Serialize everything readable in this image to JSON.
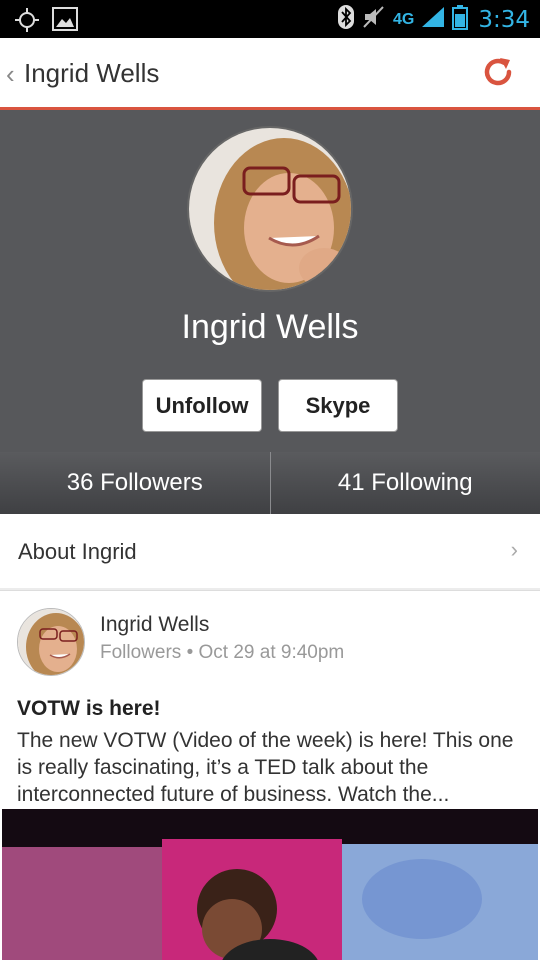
{
  "status_bar": {
    "network": "4G",
    "time": "3:34"
  },
  "action_bar": {
    "title": "Ingrid Wells"
  },
  "profile": {
    "name": "Ingrid Wells",
    "unfollow_label": "Unfollow",
    "skype_label": "Skype",
    "followers_label": "36 Followers",
    "following_label": "41 Following"
  },
  "about": {
    "label": "About Ingrid"
  },
  "post": {
    "author": "Ingrid Wells",
    "meta": "Followers • Oct 29 at 9:40pm",
    "title": "VOTW is here!",
    "body": "The new VOTW (Video of the week) is here! This one is really fascinating, it’s a TED talk about the interconnected future of business. Watch the..."
  },
  "colors": {
    "accent": "#d9543f",
    "header_bg": "#57585b",
    "status_blue": "#33b5e5"
  }
}
